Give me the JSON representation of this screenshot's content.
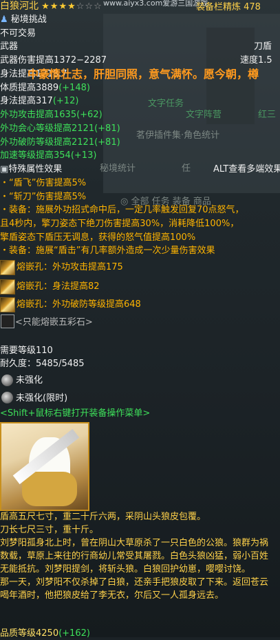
{
  "item": {
    "name": "白狼河北",
    "stars_filled": 4,
    "stars_total": 7,
    "sect_icon": "sword-sect-icon",
    "mode": "秘境挑战",
    "trade": "不可交易",
    "type_label": "武器",
    "type_value": "刀盾",
    "damage": "武器伤害提高1372−2287",
    "speed": "速度1.5"
  },
  "background": {
    "watermark": "www.aiyx3.com爱游三国游戏",
    "header_right": "装备栏精炼 478",
    "scroll_banner": "中豪情壮志，肝胆同照，意气满怀。愿今朝，樽",
    "ghost_1": "文字任务",
    "ghost_2": "文字阵营",
    "ghost_3": "茗伊插件集·角色统计",
    "ghost_4": "秘境统计",
    "ghost_5": "任",
    "ghost_tabs": "◎ 全部   任务   装备   商品",
    "ghost_6": "红三"
  },
  "stats": [
    {
      "text": "身法提高1218.7",
      "cls": "w",
      "extra": ""
    },
    {
      "text": "体质提高3889",
      "cls": "w",
      "extra": "(+148)"
    },
    {
      "text": "身法提高317",
      "cls": "w",
      "extra": "(+12)"
    },
    {
      "text": "外功攻击提高1635",
      "cls": "g",
      "extra": "(+62)"
    },
    {
      "text": "外功会心等级提高2121",
      "cls": "g",
      "extra": "(+81)"
    },
    {
      "text": "外功破防等级提高2121",
      "cls": "g",
      "extra": "(+81)"
    },
    {
      "text": "加速等级提高354",
      "cls": "g",
      "extra": "(+13)"
    }
  ],
  "special": {
    "header": "特殊属性效果",
    "alt_hint": "ALT查看多端效果",
    "lines": [
      "・“盾飞”伤害提高5%",
      "・“斩刀”伤害提高5%",
      "・装备：施展外功招式命中后，一定几率触发回复70点怒气，",
      "且4秒内，擎刀姿态下绝刀伤害提高30%，消耗降低100%，",
      "擎盾姿态下盾压无调息，获得的怒气值提高100%",
      "・装备：施展“盾击”有几率额外造成一次少量伤害效果"
    ]
  },
  "sockets": [
    "熔嵌孔：外功攻击提高175",
    "熔嵌孔：身法提高82",
    "熔嵌孔：外功破防等级提高648"
  ],
  "five_color": "<只能熔嵌五彩石>",
  "req_level": "需要等级110",
  "durability": "耐久度：5485/5485",
  "refine": [
    "未强化",
    "未强化(限时)"
  ],
  "menu_hint": "<Shift+鼠标右键打开装备操作菜单>",
  "flavor": [
    "盾高五尺七寸，重二十斤六两，采阴山头狼皮包覆。",
    "刀长七尺三寸，重十斤。",
    "刘梦阳孤身北上时，曾在阴山大草原杀了一只白色的公狼。狼群为祸数载，草原上来往的行商幼儿常受其屠戮。白色头狼凶猛，弱小百姓无能抵抗。刘梦阳提剑，将斩头狼。白狼回护幼崽，嘤嘤讨饶。",
    "那一天，刘梦阳不仅杀掉了白狼，还亲手把狼皮取了下来。返回苍云喝年酒时，他把狼皮给了李无衣，尔后又一人孤身远去。"
  ],
  "quality": "品质等级4250",
  "quality_extra": "(+162)",
  "colors": {
    "gold": "#ffd24a",
    "green": "#3ee05a",
    "orange": "#ffb400",
    "white": "#f0f0f0"
  }
}
